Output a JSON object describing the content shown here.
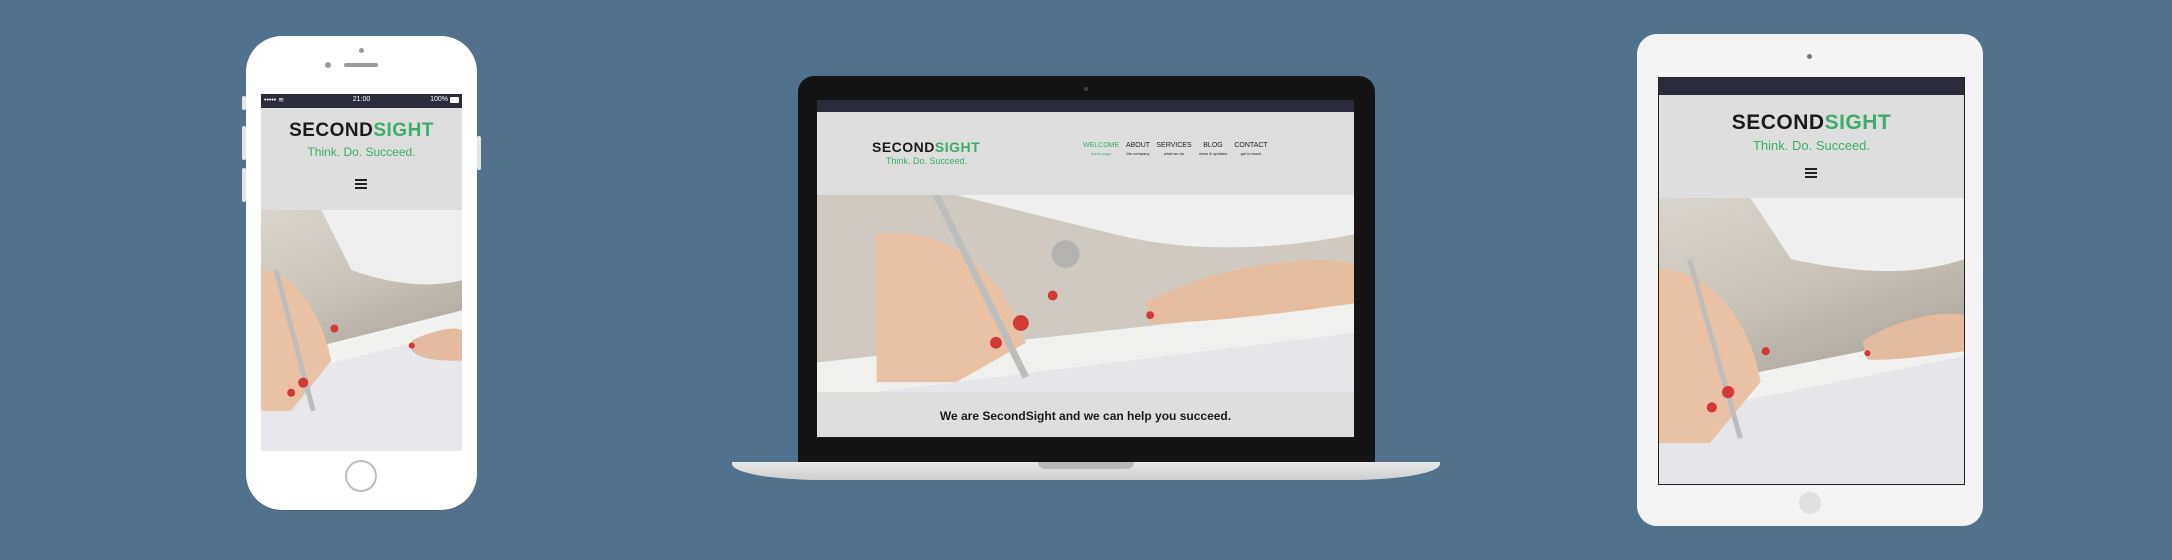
{
  "brand": {
    "logo_part1": "SECOND",
    "logo_part2": "SIGHT",
    "tagline": "Think. Do. Succeed."
  },
  "phone": {
    "status_time": "21:00",
    "status_battery": "100%",
    "status_signal": "••••• ≋",
    "menu_icon": "hamburger-icon"
  },
  "laptop": {
    "nav": [
      {
        "label": "WELCOME",
        "sub": "home page",
        "active": true
      },
      {
        "label": "ABOUT",
        "sub": "the company",
        "active": false
      },
      {
        "label": "SERVICES",
        "sub": "what we do",
        "active": false
      },
      {
        "label": "BLOG",
        "sub": "news & updates",
        "active": false
      },
      {
        "label": "CONTACT",
        "sub": "get in touch",
        "active": false
      }
    ],
    "headline": "We are SecondSight and we can help you succeed."
  },
  "tablet": {
    "menu_icon": "hamburger-icon"
  },
  "colors": {
    "background": "#52718c",
    "accent": "#3dae6a",
    "header_bg": "#dedede",
    "topbar": "#2b2b3c"
  }
}
